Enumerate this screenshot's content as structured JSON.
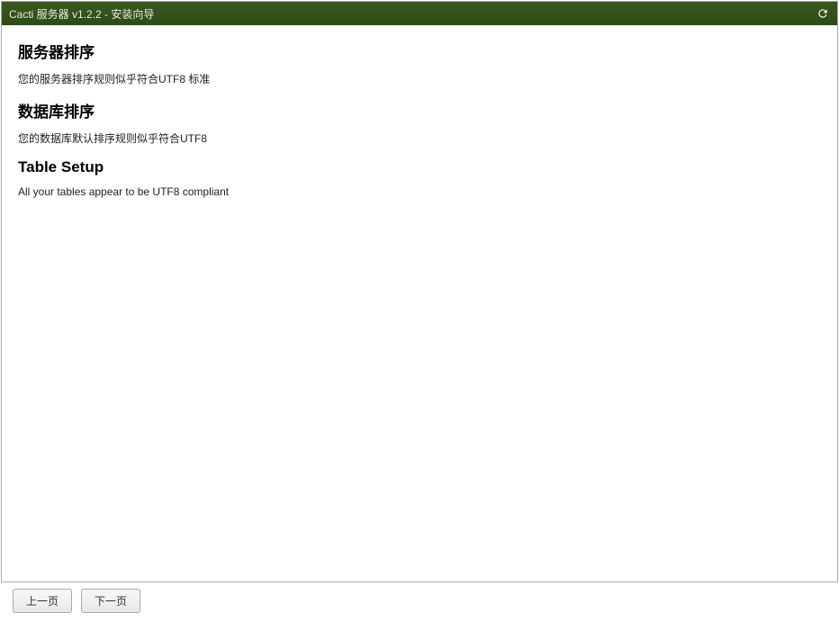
{
  "titlebar": {
    "text": "Cacti 服务器 v1.2.2 - 安装向导"
  },
  "sections": {
    "server_collation": {
      "heading": "服务器排序",
      "text": "您的服务器排序规则似乎符合UTF8 标准"
    },
    "database_collation": {
      "heading": "数据库排序",
      "text": "您的数据库默认排序规则似乎符合UTF8"
    },
    "table_setup": {
      "heading": "Table Setup",
      "text": "All your tables appear to be UTF8 compliant"
    }
  },
  "footer": {
    "prev_label": "上一页",
    "next_label": "下一页"
  }
}
